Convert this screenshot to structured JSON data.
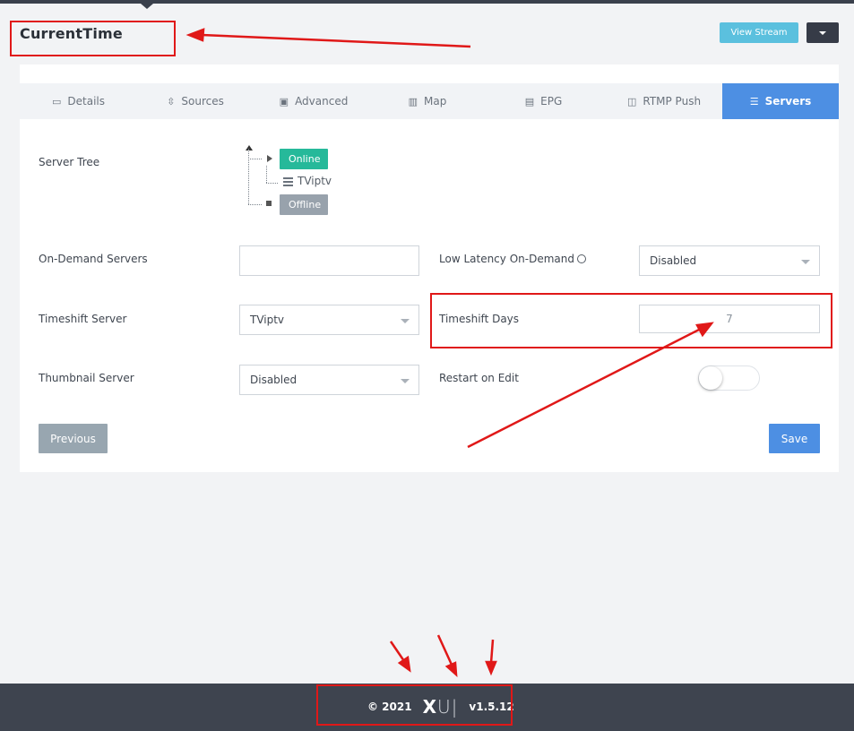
{
  "header": {
    "title": "CurrentTime",
    "view_stream_label": "View Stream"
  },
  "tabs": [
    {
      "label": "Details",
      "icon": "id-card-icon",
      "active": false
    },
    {
      "label": "Sources",
      "icon": "sources-icon",
      "active": false
    },
    {
      "label": "Advanced",
      "icon": "folder-gear-icon",
      "active": false
    },
    {
      "label": "Map",
      "icon": "map-icon",
      "active": false
    },
    {
      "label": "EPG",
      "icon": "epg-icon",
      "active": false
    },
    {
      "label": "RTMP Push",
      "icon": "monitor-icon",
      "active": false
    },
    {
      "label": "Servers",
      "icon": "server-stack-icon",
      "active": true
    }
  ],
  "form": {
    "server_tree_label": "Server Tree",
    "tree": {
      "online_label": "Online",
      "server_name": "TViptv",
      "offline_label": "Offline"
    },
    "on_demand_label": "On-Demand Servers",
    "on_demand_value": "",
    "low_latency_label": "Low Latency On-Demand",
    "low_latency_value": "Disabled",
    "timeshift_server_label": "Timeshift Server",
    "timeshift_server_value": "TViptv",
    "timeshift_days_label": "Timeshift Days",
    "timeshift_days_value": "7",
    "thumbnail_label": "Thumbnail Server",
    "thumbnail_value": "Disabled",
    "restart_label": "Restart on Edit",
    "restart_on": false
  },
  "buttons": {
    "previous": "Previous",
    "save": "Save"
  },
  "footer": {
    "copyright": "© 2021",
    "logo_bold": "X",
    "logo_light": "U|",
    "version": "v1.5.12"
  },
  "colors": {
    "accent": "#4d8fe3",
    "online": "#26b99a",
    "offline": "#98a2ac",
    "view_stream": "#5bc0de",
    "annotation": "#e01818"
  }
}
